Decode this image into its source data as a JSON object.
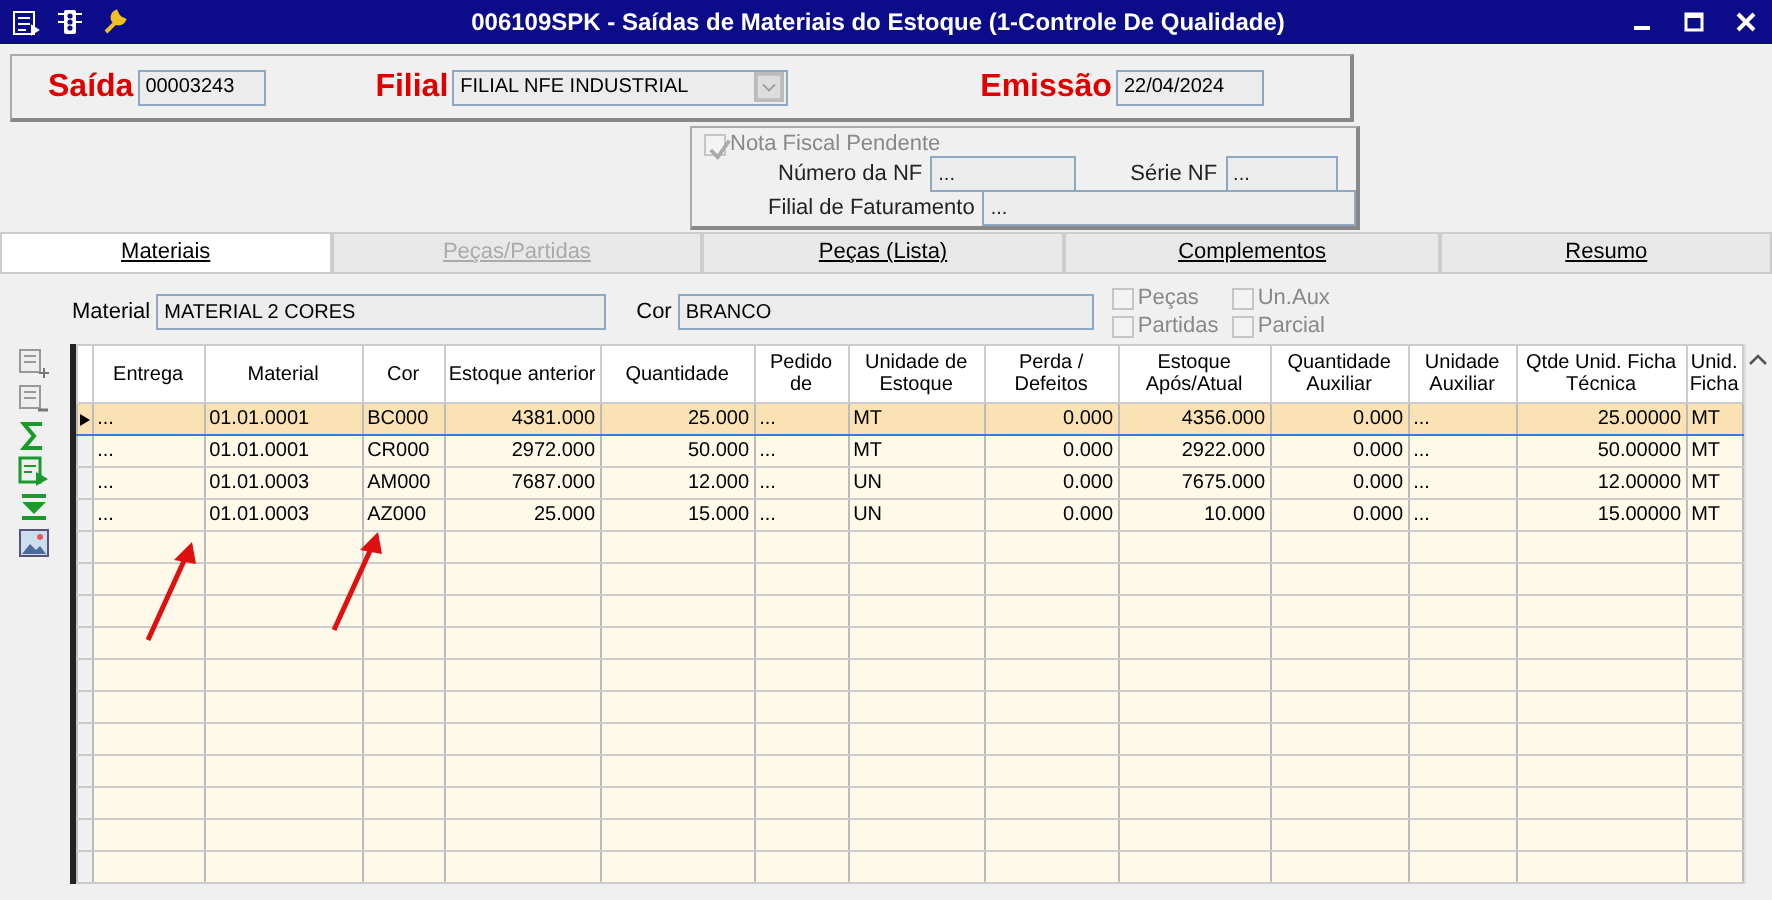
{
  "window": {
    "title": "006109SPK - Saídas de Materiais do Estoque (1-Controle De Qualidade)"
  },
  "header": {
    "saida_label": "Saída",
    "saida_value": "00003243",
    "filial_label": "Filial",
    "filial_value": "FILIAL NFE INDUSTRIAL",
    "emissao_label": "Emissão",
    "emissao_value": "22/04/2024"
  },
  "nf_panel": {
    "pendente": {
      "label": "Nota Fiscal Pendente",
      "checked": true,
      "disabled": true
    },
    "numero_label": "Número da NF",
    "numero_value": "...",
    "serie_label": "Série NF",
    "serie_value": "...",
    "faturamento_label": "Filial de Faturamento",
    "faturamento_value": "..."
  },
  "tabs": [
    {
      "label": "Materiais",
      "selected": true,
      "disabled": false
    },
    {
      "label": "Peças/Partidas",
      "selected": false,
      "disabled": true
    },
    {
      "label": "Peças (Lista)",
      "selected": false,
      "disabled": false
    },
    {
      "label": "Complementos",
      "selected": false,
      "disabled": false
    },
    {
      "label": "Resumo",
      "selected": false,
      "disabled": false
    }
  ],
  "filters": {
    "material_label": "Material",
    "material_value": "MATERIAL 2 CORES",
    "cor_label": "Cor",
    "cor_value": "BRANCO",
    "options": [
      {
        "label": "Peças",
        "checked": false,
        "disabled": true
      },
      {
        "label": "Partidas",
        "checked": false,
        "disabled": true
      },
      {
        "label": "Un.Aux",
        "checked": false,
        "disabled": true
      },
      {
        "label": "Parcial",
        "checked": false,
        "disabled": true
      }
    ]
  },
  "table": {
    "columns": [
      "Entrega",
      "Material",
      "Cor",
      "Estoque anterior",
      "Quantidade",
      "Pedido de",
      "Unidade de Estoque",
      "Perda / Defeitos",
      "Estoque Após/Atual",
      "Quantidade Auxiliar",
      "Unidade Auxiliar",
      "Qtde Unid. Ficha Técnica",
      "Unid. Ficha"
    ],
    "rows": [
      {
        "selected": true,
        "cells": [
          "...",
          "01.01.0001",
          "BC000",
          "4381.000",
          "25.000",
          "...",
          "MT",
          "0.000",
          "4356.000",
          "0.000",
          "...",
          "25.00000",
          "MT"
        ]
      },
      {
        "selected": false,
        "cells": [
          "...",
          "01.01.0001",
          "CR000",
          "2972.000",
          "50.000",
          "...",
          "MT",
          "0.000",
          "2922.000",
          "0.000",
          "...",
          "50.00000",
          "MT"
        ]
      },
      {
        "selected": false,
        "cells": [
          "...",
          "01.01.0003",
          "AM000",
          "7687.000",
          "12.000",
          "...",
          "UN",
          "0.000",
          "7675.000",
          "0.000",
          "...",
          "12.00000",
          "MT"
        ]
      },
      {
        "selected": false,
        "cells": [
          "...",
          "01.01.0003",
          "AZ000",
          "25.000",
          "15.000",
          "...",
          "UN",
          "0.000",
          "10.000",
          "0.000",
          "...",
          "15.00000",
          "MT"
        ]
      }
    ]
  }
}
